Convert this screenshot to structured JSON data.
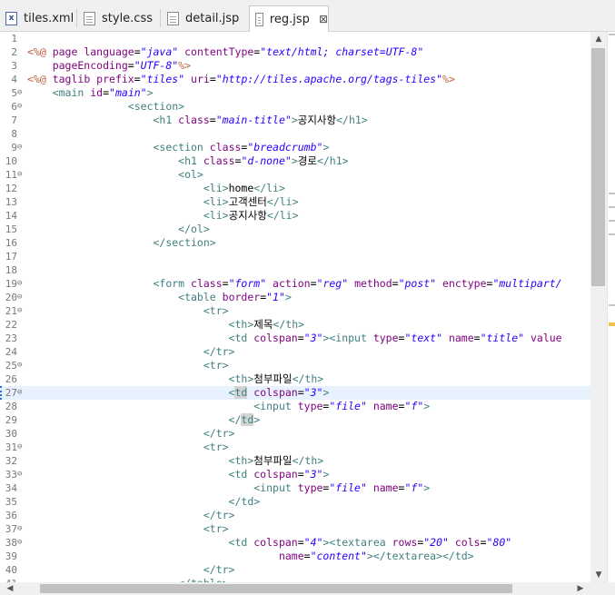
{
  "tabs": [
    {
      "label": "tiles.xml",
      "icon": "xml-file-icon",
      "icon_glyph": "x"
    },
    {
      "label": "style.css",
      "icon": "css-file-icon",
      "icon_glyph": ""
    },
    {
      "label": "detail.jsp",
      "icon": "jsp-file-icon",
      "icon_glyph": ""
    },
    {
      "label": "reg.jsp",
      "icon": "jsp-file-icon",
      "icon_glyph": "",
      "active": true,
      "close": "⊠"
    }
  ],
  "editor": {
    "current_line": 27,
    "lines": [
      {
        "n": "1",
        "fold": "",
        "segs": []
      },
      {
        "n": "2",
        "fold": "",
        "segs": [
          [
            "dl",
            "<%@ "
          ],
          [
            "an",
            "page language"
          ],
          [
            "",
            "="
          ],
          [
            "av",
            "\"java\""
          ],
          [
            "an",
            " contentType"
          ],
          [
            "",
            "="
          ],
          [
            "av",
            "\"text/html; charset=UTF-8\""
          ]
        ]
      },
      {
        "n": "3",
        "fold": "",
        "segs": [
          [
            "an",
            "    pageEncoding"
          ],
          [
            "",
            "="
          ],
          [
            "av",
            "\"UTF-8\""
          ],
          [
            "dl",
            "%>"
          ]
        ]
      },
      {
        "n": "4",
        "fold": "",
        "segs": [
          [
            "dl",
            "<%@ "
          ],
          [
            "an",
            "taglib prefix"
          ],
          [
            "",
            "="
          ],
          [
            "av",
            "\"tiles\""
          ],
          [
            "an",
            " uri"
          ],
          [
            "",
            "="
          ],
          [
            "av",
            "\"http://tiles.apache.org/tags-tiles\""
          ],
          [
            "dl",
            "%>"
          ]
        ]
      },
      {
        "n": "5",
        "fold": "⊖",
        "segs": [
          [
            "tg",
            "    <main "
          ],
          [
            "an",
            "id"
          ],
          [
            "",
            "="
          ],
          [
            "av",
            "\"main\""
          ],
          [
            "tg",
            ">"
          ]
        ]
      },
      {
        "n": "6",
        "fold": "⊖",
        "segs": [
          [
            "tg",
            "                <section>"
          ]
        ]
      },
      {
        "n": "7",
        "fold": "",
        "segs": [
          [
            "tg",
            "                    <h1 "
          ],
          [
            "an",
            "class"
          ],
          [
            "",
            "="
          ],
          [
            "av",
            "\"main-title\""
          ],
          [
            "tg",
            ">"
          ],
          [
            "",
            "공지사항"
          ],
          [
            "tg",
            "</h1>"
          ]
        ]
      },
      {
        "n": "8",
        "fold": "",
        "segs": []
      },
      {
        "n": "9",
        "fold": "⊖",
        "segs": [
          [
            "tg",
            "                    <section "
          ],
          [
            "an",
            "class"
          ],
          [
            "",
            "="
          ],
          [
            "av",
            "\"breadcrumb\""
          ],
          [
            "tg",
            ">"
          ]
        ]
      },
      {
        "n": "10",
        "fold": "",
        "segs": [
          [
            "tg",
            "                        <h1 "
          ],
          [
            "an",
            "class"
          ],
          [
            "",
            "="
          ],
          [
            "av",
            "\"d-none\""
          ],
          [
            "tg",
            ">"
          ],
          [
            "",
            "경로"
          ],
          [
            "tg",
            "</h1>"
          ]
        ]
      },
      {
        "n": "11",
        "fold": "⊖",
        "segs": [
          [
            "tg",
            "                        <ol>"
          ]
        ]
      },
      {
        "n": "12",
        "fold": "",
        "segs": [
          [
            "tg",
            "                            <li>"
          ],
          [
            "",
            "home"
          ],
          [
            "tg",
            "</li>"
          ]
        ]
      },
      {
        "n": "13",
        "fold": "",
        "segs": [
          [
            "tg",
            "                            <li>"
          ],
          [
            "",
            "고객센터"
          ],
          [
            "tg",
            "</li>"
          ]
        ]
      },
      {
        "n": "14",
        "fold": "",
        "segs": [
          [
            "tg",
            "                            <li>"
          ],
          [
            "",
            "공지사항"
          ],
          [
            "tg",
            "</li>"
          ]
        ]
      },
      {
        "n": "15",
        "fold": "",
        "segs": [
          [
            "tg",
            "                        </ol>"
          ]
        ]
      },
      {
        "n": "16",
        "fold": "",
        "segs": [
          [
            "tg",
            "                    </section>"
          ]
        ]
      },
      {
        "n": "17",
        "fold": "",
        "segs": []
      },
      {
        "n": "18",
        "fold": "",
        "segs": []
      },
      {
        "n": "19",
        "fold": "⊖",
        "segs": [
          [
            "tg",
            "                    <form "
          ],
          [
            "an",
            "class"
          ],
          [
            "",
            "="
          ],
          [
            "av",
            "\"form\""
          ],
          [
            "an",
            " action"
          ],
          [
            "",
            "="
          ],
          [
            "av",
            "\"reg\""
          ],
          [
            "an",
            " method"
          ],
          [
            "",
            "="
          ],
          [
            "av",
            "\"post\""
          ],
          [
            "an",
            " enctype"
          ],
          [
            "",
            "="
          ],
          [
            "av",
            "\"multipart/"
          ]
        ]
      },
      {
        "n": "20",
        "fold": "⊖",
        "segs": [
          [
            "tg",
            "                        <table "
          ],
          [
            "an",
            "border"
          ],
          [
            "",
            "="
          ],
          [
            "av",
            "\"1\""
          ],
          [
            "tg",
            ">"
          ]
        ]
      },
      {
        "n": "21",
        "fold": "⊖",
        "segs": [
          [
            "tg",
            "                            <tr>"
          ]
        ]
      },
      {
        "n": "22",
        "fold": "",
        "segs": [
          [
            "tg",
            "                                <th>"
          ],
          [
            "",
            "제목"
          ],
          [
            "tg",
            "</th>"
          ]
        ]
      },
      {
        "n": "23",
        "fold": "",
        "segs": [
          [
            "tg",
            "                                <td "
          ],
          [
            "an",
            "colspan"
          ],
          [
            "",
            "="
          ],
          [
            "av",
            "\"3\""
          ],
          [
            "tg",
            "><input "
          ],
          [
            "an",
            "type"
          ],
          [
            "",
            "="
          ],
          [
            "av",
            "\"text\""
          ],
          [
            "an",
            " name"
          ],
          [
            "",
            "="
          ],
          [
            "av",
            "\"title\""
          ],
          [
            "an",
            " value"
          ]
        ]
      },
      {
        "n": "24",
        "fold": "",
        "segs": [
          [
            "tg",
            "                            </tr>"
          ]
        ]
      },
      {
        "n": "25",
        "fold": "⊖",
        "segs": [
          [
            "tg",
            "                            <tr>"
          ]
        ]
      },
      {
        "n": "26",
        "fold": "",
        "segs": [
          [
            "tg",
            "                                <th>"
          ],
          [
            "",
            "첨부파일"
          ],
          [
            "tg",
            "</th>"
          ]
        ]
      },
      {
        "n": "27",
        "fold": "⊖",
        "segs": [
          [
            "tg",
            "                                <"
          ],
          [
            "tg hl",
            "td"
          ],
          [
            "an",
            " colspan"
          ],
          [
            "",
            "="
          ],
          [
            "av",
            "\"3\""
          ],
          [
            "tg",
            ">"
          ]
        ]
      },
      {
        "n": "28",
        "fold": "",
        "segs": [
          [
            "tg",
            "                                    <input "
          ],
          [
            "an",
            "type"
          ],
          [
            "",
            "="
          ],
          [
            "av",
            "\"file\""
          ],
          [
            "an",
            " name"
          ],
          [
            "",
            "="
          ],
          [
            "av",
            "\"f\""
          ],
          [
            "tg",
            ">"
          ]
        ]
      },
      {
        "n": "29",
        "fold": "",
        "segs": [
          [
            "tg",
            "                                </"
          ],
          [
            "tg hl",
            "td"
          ],
          [
            "tg",
            ">"
          ]
        ]
      },
      {
        "n": "30",
        "fold": "",
        "segs": [
          [
            "tg",
            "                            </tr>"
          ]
        ]
      },
      {
        "n": "31",
        "fold": "⊖",
        "segs": [
          [
            "tg",
            "                            <tr>"
          ]
        ]
      },
      {
        "n": "32",
        "fold": "",
        "segs": [
          [
            "tg",
            "                                <th>"
          ],
          [
            "",
            "첨부파일"
          ],
          [
            "tg",
            "</th>"
          ]
        ]
      },
      {
        "n": "33",
        "fold": "⊖",
        "segs": [
          [
            "tg",
            "                                <td "
          ],
          [
            "an",
            "colspan"
          ],
          [
            "",
            "="
          ],
          [
            "av",
            "\"3\""
          ],
          [
            "tg",
            ">"
          ]
        ]
      },
      {
        "n": "34",
        "fold": "",
        "segs": [
          [
            "tg",
            "                                    <input "
          ],
          [
            "an",
            "type"
          ],
          [
            "",
            "="
          ],
          [
            "av",
            "\"file\""
          ],
          [
            "an",
            " name"
          ],
          [
            "",
            "="
          ],
          [
            "av",
            "\"f\""
          ],
          [
            "tg",
            ">"
          ]
        ]
      },
      {
        "n": "35",
        "fold": "",
        "segs": [
          [
            "tg",
            "                                </td>"
          ]
        ]
      },
      {
        "n": "36",
        "fold": "",
        "segs": [
          [
            "tg",
            "                            </tr>"
          ]
        ]
      },
      {
        "n": "37",
        "fold": "⊖",
        "segs": [
          [
            "tg",
            "                            <tr>"
          ]
        ]
      },
      {
        "n": "38",
        "fold": "⊖",
        "segs": [
          [
            "tg",
            "                                <td "
          ],
          [
            "an",
            "colspan"
          ],
          [
            "",
            "="
          ],
          [
            "av",
            "\"4\""
          ],
          [
            "tg",
            "><textarea "
          ],
          [
            "an",
            "rows"
          ],
          [
            "",
            "="
          ],
          [
            "av",
            "\"20\""
          ],
          [
            "an",
            " cols"
          ],
          [
            "",
            "="
          ],
          [
            "av",
            "\"80\""
          ]
        ]
      },
      {
        "n": "39",
        "fold": "",
        "segs": [
          [
            "an",
            "                                        name"
          ],
          [
            "",
            "="
          ],
          [
            "av",
            "\"content\""
          ],
          [
            "tg",
            "></textarea></td>"
          ]
        ]
      },
      {
        "n": "40",
        "fold": "",
        "segs": [
          [
            "tg",
            "                            </tr>"
          ]
        ]
      },
      {
        "n": "41",
        "fold": "",
        "segs": [
          [
            "tg",
            "                        </table>"
          ]
        ]
      }
    ]
  },
  "scroll_icons": {
    "up": "▲",
    "down": "▼",
    "left": "◀",
    "right": "▶"
  }
}
